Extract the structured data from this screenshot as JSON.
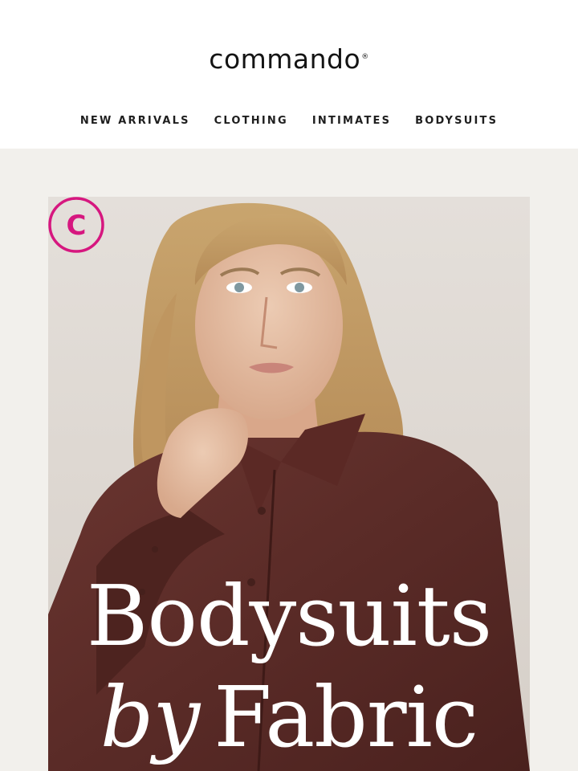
{
  "brand": {
    "name": "commando",
    "mark": "®"
  },
  "nav": {
    "items": [
      {
        "label": "NEW ARRIVALS"
      },
      {
        "label": "CLOTHING"
      },
      {
        "label": "INTIMATES"
      },
      {
        "label": "BODYSUITS"
      }
    ]
  },
  "hero": {
    "headline_line1": "Bodysuits",
    "headline_line2_italic": "by",
    "headline_line2": "Fabric",
    "badge_letter": "C",
    "image_icon": "model-photo-icon",
    "colors": {
      "badge": "#d6177f",
      "shirt": "#5a2b27",
      "text": "#ffffff"
    }
  }
}
